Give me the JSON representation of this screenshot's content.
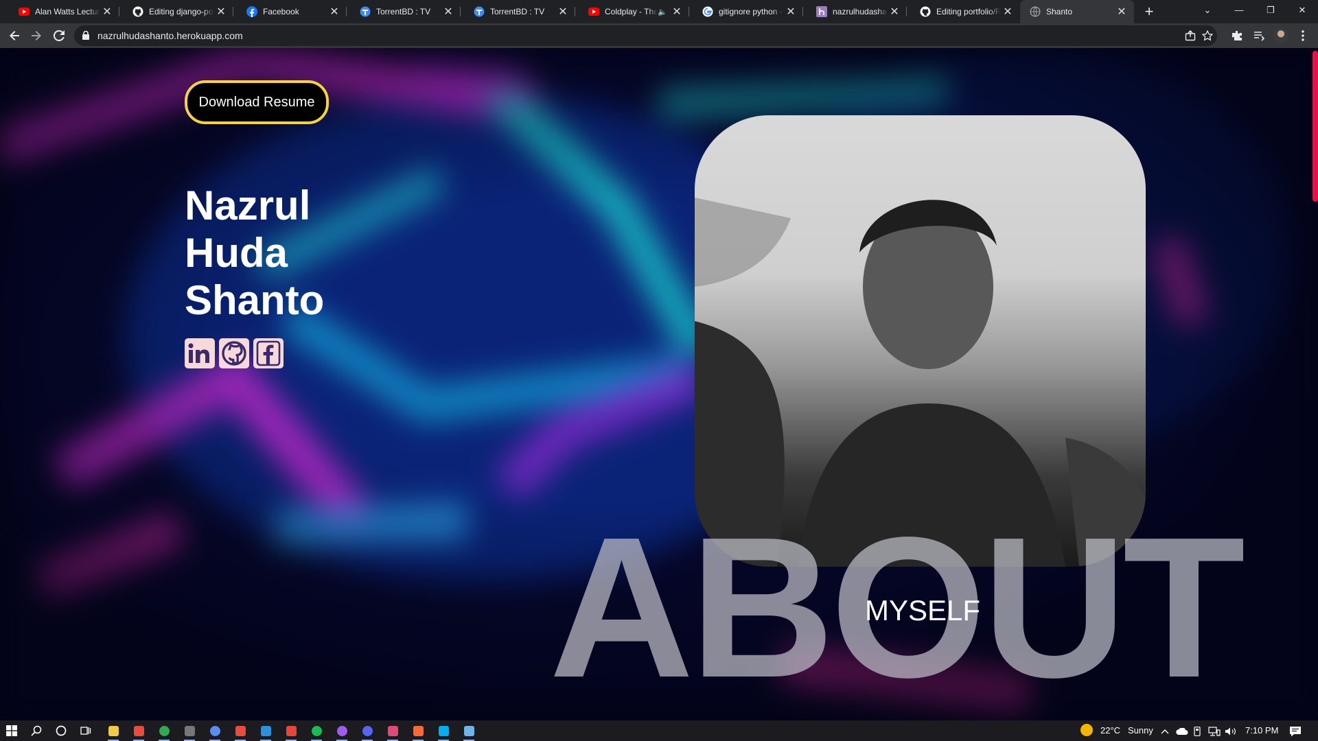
{
  "browser": {
    "tabs": [
      {
        "title": "Alan Watts Lecture",
        "icon": "youtube-icon",
        "color": "#ff0000"
      },
      {
        "title": "Editing django-por",
        "icon": "github-icon",
        "color": "#ffffff"
      },
      {
        "title": "Facebook",
        "icon": "facebook-icon",
        "color": "#1877f2"
      },
      {
        "title": "TorrentBD : TV",
        "icon": "torrentbd-icon",
        "color": "#3d8bfd"
      },
      {
        "title": "TorrentBD : TV",
        "icon": "torrentbd-icon",
        "color": "#3d8bfd"
      },
      {
        "title": "Coldplay - The",
        "icon": "youtube-icon",
        "color": "#ff0000",
        "audio": true
      },
      {
        "title": "gitignore python -",
        "icon": "google-icon",
        "color": "#ffffff"
      },
      {
        "title": "nazrulhudashanto",
        "icon": "heroku-icon",
        "color": "#9e7cc1"
      },
      {
        "title": "Editing portfolio/R",
        "icon": "github-icon",
        "color": "#ffffff"
      },
      {
        "title": "Shanto",
        "icon": "globe-icon",
        "color": "#9aa0a6",
        "active": true
      }
    ],
    "close_glyph": "✕",
    "new_tab_glyph": "+",
    "url": "nazrulhudashanto.herokuapp.com",
    "window_controls": {
      "tab_search": "⌄",
      "minimize": "—",
      "maximize": "❐",
      "close": "✕"
    }
  },
  "page": {
    "resume_button": "Download Resume",
    "name_lines": [
      "Nazrul",
      "Huda",
      "Shanto"
    ],
    "social": [
      {
        "name": "linkedin",
        "icon": "linkedin-icon"
      },
      {
        "name": "github",
        "icon": "github-icon"
      },
      {
        "name": "facebook",
        "icon": "facebook-icon"
      }
    ],
    "about_big": "ABOUT",
    "about_sub": "MYSELF",
    "colors": {
      "button_border": "#f6d23c",
      "social_bg": "#f7d9dc",
      "social_fg": "#3a2a6a",
      "scrollbar": "#e0134a"
    }
  },
  "taskbar": {
    "weather_temp": "22°C",
    "weather_desc": "Sunny",
    "time": "7:10 PM",
    "apps": [
      {
        "icon": "file-explorer-icon",
        "color": "#f2c94c"
      },
      {
        "icon": "office-icon",
        "color": "#e74c3c"
      },
      {
        "icon": "chrome-icon",
        "color": "#34a853"
      },
      {
        "icon": "mouse-icon",
        "color": "#777777"
      },
      {
        "icon": "globe-app-icon",
        "color": "#5b8def"
      },
      {
        "icon": "office-icon",
        "color": "#e74c3c"
      },
      {
        "icon": "vscode-icon",
        "color": "#2f8fd8"
      },
      {
        "icon": "app-red-icon",
        "color": "#e8453c"
      },
      {
        "icon": "spotify-icon",
        "color": "#1db954"
      },
      {
        "icon": "messenger-icon",
        "color": "#a05cf0"
      },
      {
        "icon": "discord-icon",
        "color": "#5865f2"
      },
      {
        "icon": "app-pink-icon",
        "color": "#e04a7a"
      },
      {
        "icon": "app-orange-icon",
        "color": "#f26b3a"
      },
      {
        "icon": "skype-icon",
        "color": "#00aff0"
      },
      {
        "icon": "keyboard-icon",
        "color": "#6fb3e8"
      }
    ]
  }
}
